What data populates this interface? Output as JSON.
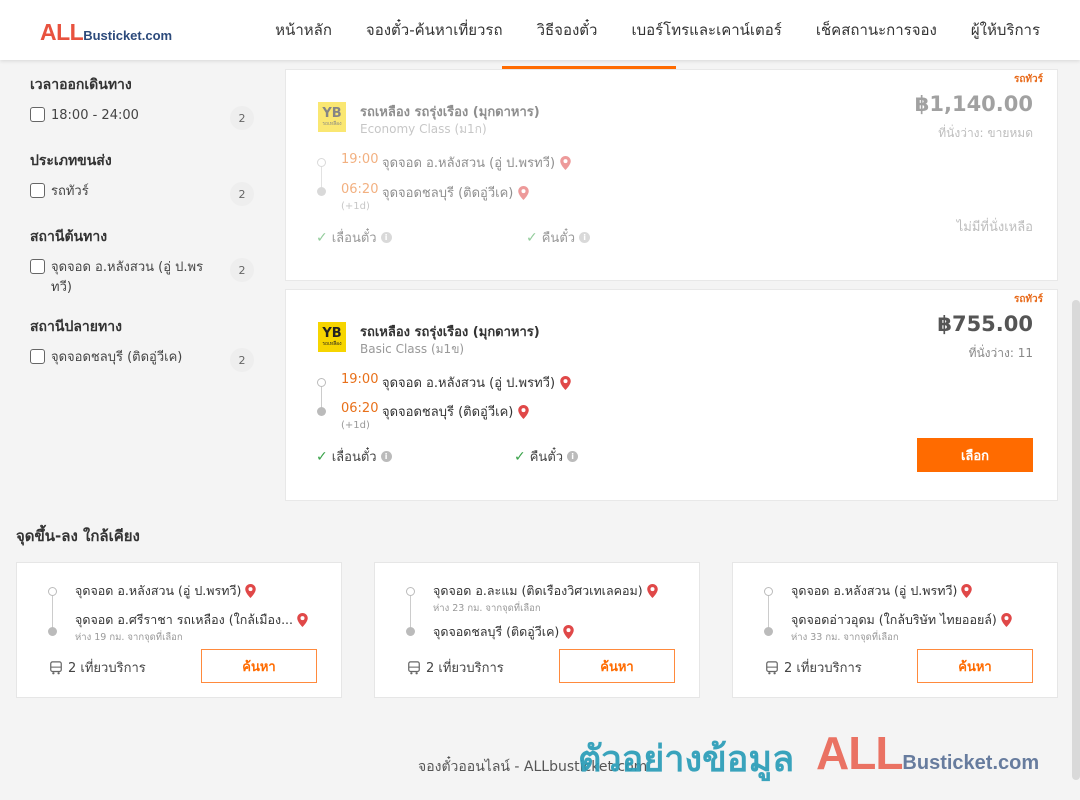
{
  "header": {
    "logo_all": "ALL",
    "logo_rest": "Busticket.com",
    "nav": [
      "หน้าหลัก",
      "จองตั๋ว-ค้นหาเที่ยวรถ",
      "วิธีจองตั๋ว",
      "เบอร์โทรและเคาน์เตอร์",
      "เช็คสถานะการจอง",
      "ผู้ให้บริการ"
    ],
    "active_index": 2
  },
  "filters": [
    {
      "title": "เวลาออกเดินทาง",
      "option": "18:00 - 24:00",
      "count": "2"
    },
    {
      "title": "ประเภทขนส่ง",
      "option": "รถทัวร์",
      "count": "2"
    },
    {
      "title": "สถานีต้นทาง",
      "option": "จุดจอด อ.หลังสวน (อู่ ป.พรทวี)",
      "count": "2"
    },
    {
      "title": "สถานีปลายทาง",
      "option": "จุดจอดชลบุรี (ติดอู่วีเค)",
      "count": "2"
    }
  ],
  "trips": [
    {
      "tag": "รถทัวร์",
      "operator": "รถเหลือง รถรุ่งเรือง (มุกดาหาร)",
      "class": "Economy Class (ม1ก)",
      "price": "฿1,140.00",
      "seats": "ที่นั่งว่าง: ขายหมด",
      "depart_time": "19:00",
      "depart_stop": "จุดจอด อ.หลังสวน (อู่ ป.พรทวี)",
      "arrive_time": "06:20",
      "arrive_stop": "จุดจอดชลบุรี (ติดอู่วีเค)",
      "next_day": "(+1d)",
      "feature1": "เลื่อนตั๋ว",
      "feature2": "คืนตั๋ว",
      "status": "ไม่มีที่นั่งเหลือ"
    },
    {
      "tag": "รถทัวร์",
      "operator": "รถเหลือง รถรุ่งเรือง (มุกดาหาร)",
      "class": "Basic Class (ม1ข)",
      "price": "฿755.00",
      "seats": "ที่นั่งว่าง: 11",
      "depart_time": "19:00",
      "depart_stop": "จุดจอด อ.หลังสวน (อู่ ป.พรทวี)",
      "arrive_time": "06:20",
      "arrive_stop": "จุดจอดชลบุรี (ติดอู่วีเค)",
      "next_day": "(+1d)",
      "feature1": "เลื่อนตั๋ว",
      "feature2": "คืนตั๋ว",
      "button": "เลือก"
    }
  ],
  "operator_logo": {
    "text": "YB",
    "sub": "รถเหลือง"
  },
  "nearby": {
    "title": "จุดขึ้น-ลง ใกล้เคียง",
    "cards": [
      {
        "from": "จุดจอด อ.หลังสวน (อู่ ป.พรทวี)",
        "from_sub": "",
        "to": "จุดจอด อ.ศรีราชา รถเหลือง (ใกล้เมือง...",
        "to_sub": "ห่าง 19 กม. จากจุดที่เลือก",
        "trips": "2 เที่ยวบริการ",
        "button": "ค้นหา"
      },
      {
        "from": "จุดจอด อ.ละแม (ติดเรือง​วิศวเทเลคอม)",
        "from_sub": "ห่าง 23 กม. จากจุดที่เลือก",
        "to": "จุดจอดชลบุรี (ติดอู่วีเค)",
        "to_sub": "",
        "trips": "2 เที่ยวบริการ",
        "button": "ค้นหา"
      },
      {
        "from": "จุดจอด อ.หลังสวน (อู่ ป.พรทวี)",
        "from_sub": "",
        "to": "จุดจอดอ่าวอุดม (ใกล้บริษัท ไทยออยล์)",
        "to_sub": "ห่าง 33 กม. จากจุดที่เลือก",
        "trips": "2 เที่ยวบริการ",
        "button": "ค้นหา"
      }
    ]
  },
  "footer": {
    "text": "จองตั๋วออนไลน์ - ALLbusticket.com",
    "watermark_thai": "ตัวอย่างข้อมูล",
    "watermark_all": "ALL",
    "watermark_rest": "Busticket.com"
  },
  "colors": {
    "accent": "#ff6b00",
    "time": "#e8701a",
    "check": "#3aa34a",
    "pin": "#e04848"
  }
}
